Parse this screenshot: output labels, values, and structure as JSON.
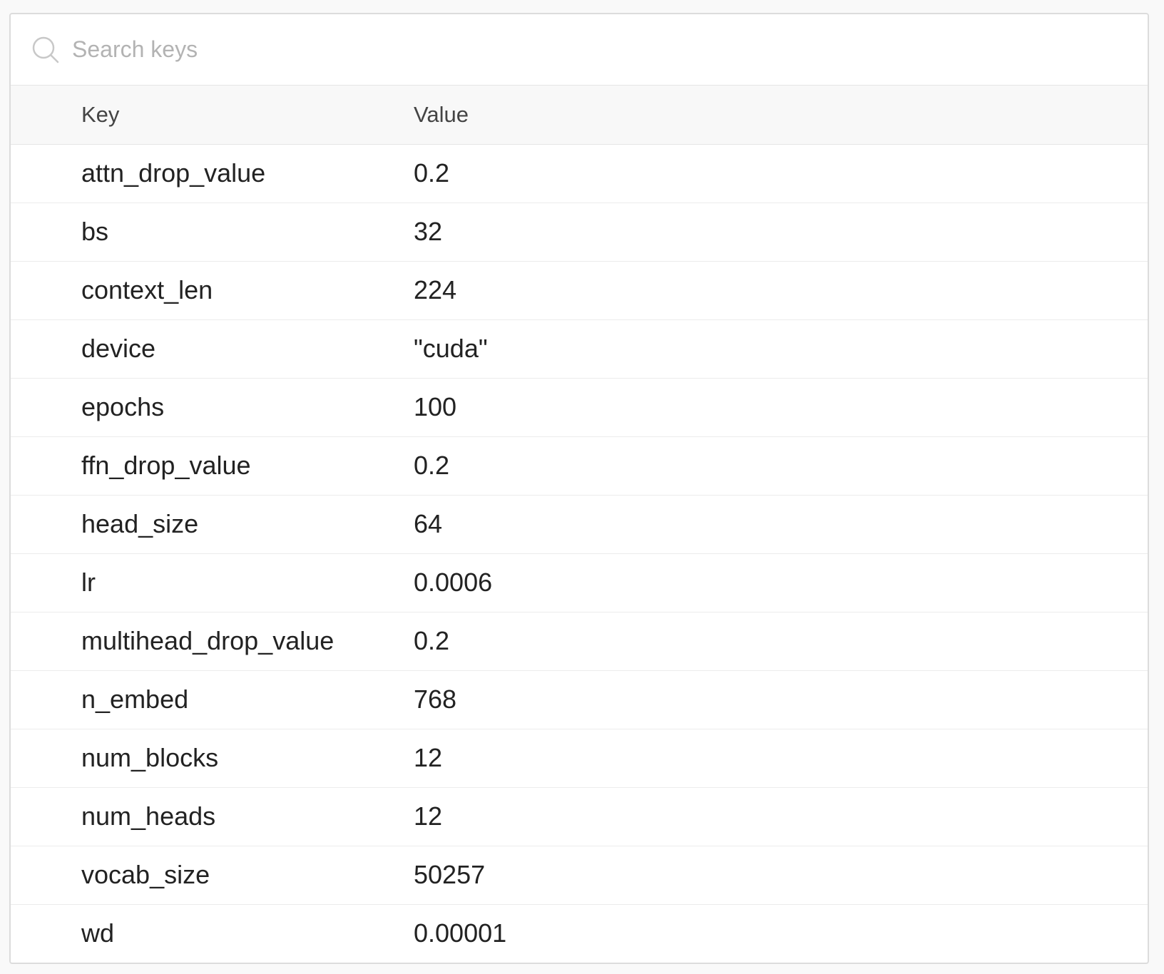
{
  "search": {
    "placeholder": "Search keys",
    "value": "",
    "icon": "search-icon"
  },
  "table": {
    "headers": {
      "key": "Key",
      "value": "Value"
    },
    "rows": [
      {
        "key": "attn_drop_value",
        "value": "0.2"
      },
      {
        "key": "bs",
        "value": "32"
      },
      {
        "key": "context_len",
        "value": "224"
      },
      {
        "key": "device",
        "value": "\"cuda\""
      },
      {
        "key": "epochs",
        "value": "100"
      },
      {
        "key": "ffn_drop_value",
        "value": "0.2"
      },
      {
        "key": "head_size",
        "value": "64"
      },
      {
        "key": "lr",
        "value": "0.0006"
      },
      {
        "key": "multihead_drop_value",
        "value": "0.2"
      },
      {
        "key": "n_embed",
        "value": "768"
      },
      {
        "key": "num_blocks",
        "value": "12"
      },
      {
        "key": "num_heads",
        "value": "12"
      },
      {
        "key": "vocab_size",
        "value": "50257"
      },
      {
        "key": "wd",
        "value": "0.00001"
      }
    ]
  },
  "colors": {
    "background": "#f9f9f9",
    "panel": "#ffffff",
    "border": "#dcdcdc",
    "header_bg": "#f8f8f8",
    "placeholder": "#b3b3b3",
    "text": "#222222"
  }
}
